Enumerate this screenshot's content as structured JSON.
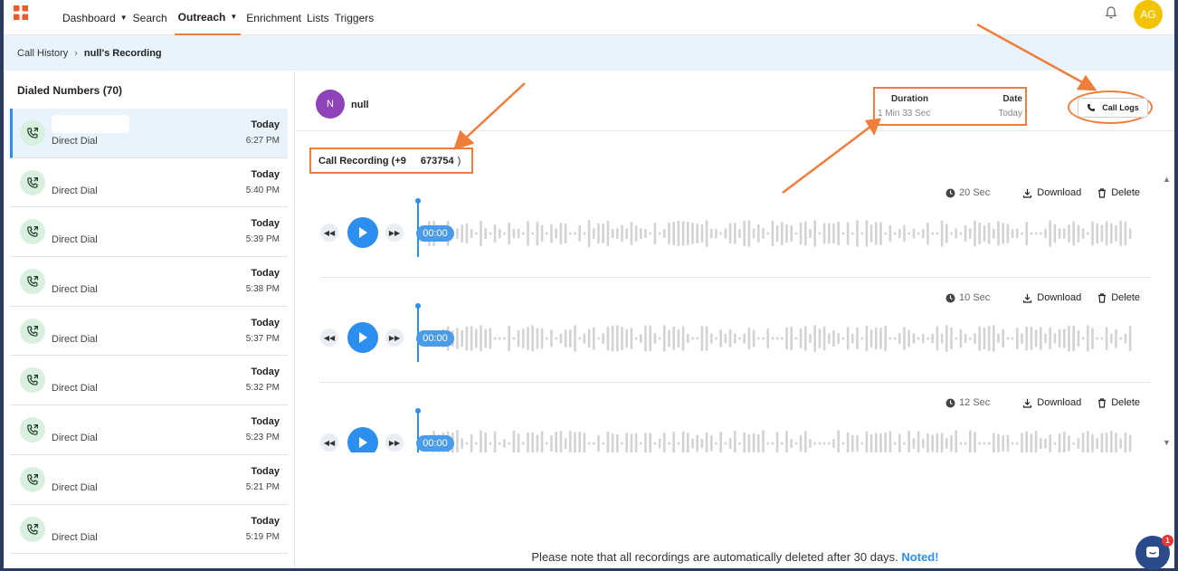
{
  "colors": {
    "accent": "#2c8ff0",
    "annotation": "#ef7d3c",
    "avatar": "#f2c400",
    "contact": "#8e44b8"
  },
  "nav": {
    "items": [
      {
        "label": "Dashboard",
        "has_caret": true
      },
      {
        "label": "Search"
      },
      {
        "label": "Outreach",
        "has_caret": true,
        "active": true
      },
      {
        "label": "Enrichment"
      },
      {
        "label": "Lists"
      },
      {
        "label": "Triggers"
      }
    ],
    "avatar": "AG",
    "bell_icon": "bell-icon",
    "logo_icon": "app-logo-icon"
  },
  "breadcrumb": {
    "link": "Call History",
    "separator": "›",
    "current": "null's Recording"
  },
  "left": {
    "title": "Dialed Numbers (70)",
    "items": [
      {
        "type": "Direct Dial",
        "day": "Today",
        "time": "6:27 PM",
        "selected": true
      },
      {
        "type": "Direct Dial",
        "day": "Today",
        "time": "5:40 PM"
      },
      {
        "type": "Direct Dial",
        "day": "Today",
        "time": "5:39 PM"
      },
      {
        "type": "Direct Dial",
        "day": "Today",
        "time": "5:38 PM"
      },
      {
        "type": "Direct Dial",
        "day": "Today",
        "time": "5:37 PM"
      },
      {
        "type": "Direct Dial",
        "day": "Today",
        "time": "5:32 PM"
      },
      {
        "type": "Direct Dial",
        "day": "Today",
        "time": "5:23 PM"
      },
      {
        "type": "Direct Dial",
        "day": "Today",
        "time": "5:21 PM"
      },
      {
        "type": "Direct Dial",
        "day": "Today",
        "time": "5:19 PM"
      }
    ]
  },
  "contact": {
    "initial": "N",
    "name": "null",
    "duration_label": "Duration",
    "duration_value": "1 Min 33 Sec",
    "date_label": "Date",
    "date_value": "Today",
    "call_logs_label": "Call Logs"
  },
  "recording": {
    "title_prefix": "Call Recording (+9",
    "title_number": "673754",
    "title_suffix": ")",
    "download_label": "Download",
    "delete_label": "Delete",
    "items": [
      {
        "duration": "20 Sec",
        "time": "00:00"
      },
      {
        "duration": "10 Sec",
        "time": "00:00"
      },
      {
        "duration": "12 Sec",
        "time": "00:00"
      }
    ]
  },
  "notice": {
    "text": "Please note that all recordings are automatically deleted after 30 days.",
    "action": "Noted!"
  },
  "chat": {
    "badge": "1"
  }
}
